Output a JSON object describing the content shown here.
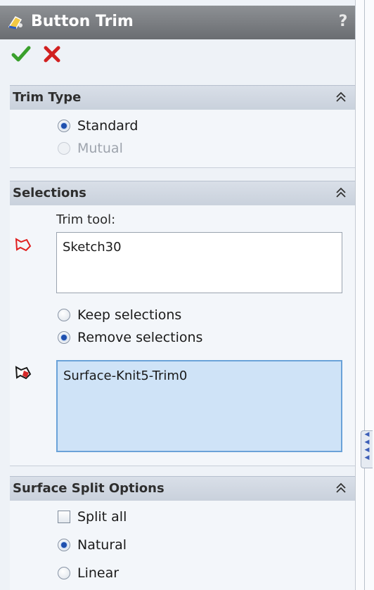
{
  "title": "Button Trim",
  "help_label": "?",
  "trim_type": {
    "header": "Trim Type",
    "options": [
      {
        "label": "Standard",
        "selected": true,
        "enabled": true
      },
      {
        "label": "Mutual",
        "selected": false,
        "enabled": false
      }
    ]
  },
  "selections": {
    "header": "Selections",
    "trim_tool_label": "Trim tool:",
    "trim_tool_value": "Sketch30",
    "keep_label": "Keep selections",
    "remove_label": "Remove selections",
    "remove_selected": true,
    "pieces_value": "Surface-Knit5-Trim0"
  },
  "surface_split": {
    "header": "Surface Split Options",
    "split_all_label": "Split all",
    "split_all_checked": false,
    "natural_label": "Natural",
    "linear_label": "Linear",
    "selected": "Natural"
  },
  "colors": {
    "title_bar": "#7b7e82",
    "group_header": "#d0d7e1",
    "active_field": "#cfe3f7",
    "ok_green": "#3aa02c",
    "cancel_red": "#d12020",
    "radio_dot": "#1e4fae"
  }
}
